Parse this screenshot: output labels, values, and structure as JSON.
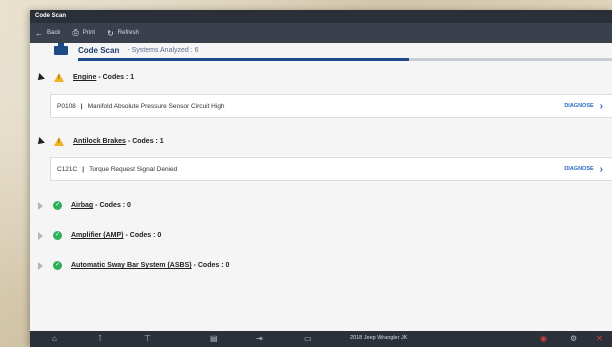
{
  "window": {
    "title": "Code Scan"
  },
  "toolbar": {
    "back_label": "Back",
    "print_label": "Print",
    "refresh_label": "Refresh"
  },
  "scan": {
    "title": "Code Scan",
    "subtitle": "- Systems Analyzed : 6",
    "progress": 0.62
  },
  "systems": [
    {
      "name": "Engine",
      "codes_label": "- Codes : 1",
      "status": "warning",
      "expanded": true,
      "dtc": {
        "code": "P0108",
        "description": "Manifold Absolute Pressure Sensor Circuit High",
        "action": "DIAGNOSE"
      }
    },
    {
      "name": "Antilock Brakes",
      "codes_label": "- Codes : 1",
      "status": "warning",
      "expanded": true,
      "dtc": {
        "code": "C121C",
        "description": "Torque Request Signal Denied",
        "action": "DIAGNOSE"
      }
    },
    {
      "name": "Airbag",
      "codes_label": "- Codes : 0",
      "status": "ok",
      "expanded": false
    },
    {
      "name": "Amplifier (AMP)",
      "codes_label": "- Codes : 0",
      "status": "ok",
      "expanded": false
    },
    {
      "name": "Automatic Sway Bar System (ASBS)",
      "codes_label": "- Codes : 0",
      "status": "ok",
      "expanded": false
    }
  ],
  "bottom_bar": {
    "vehicle": "2018 Jeep Wrangler JK"
  },
  "colors": {
    "accent": "#1d4a88",
    "warning": "#f2b320",
    "ok": "#2fae5b",
    "link": "#2b6cc4"
  }
}
